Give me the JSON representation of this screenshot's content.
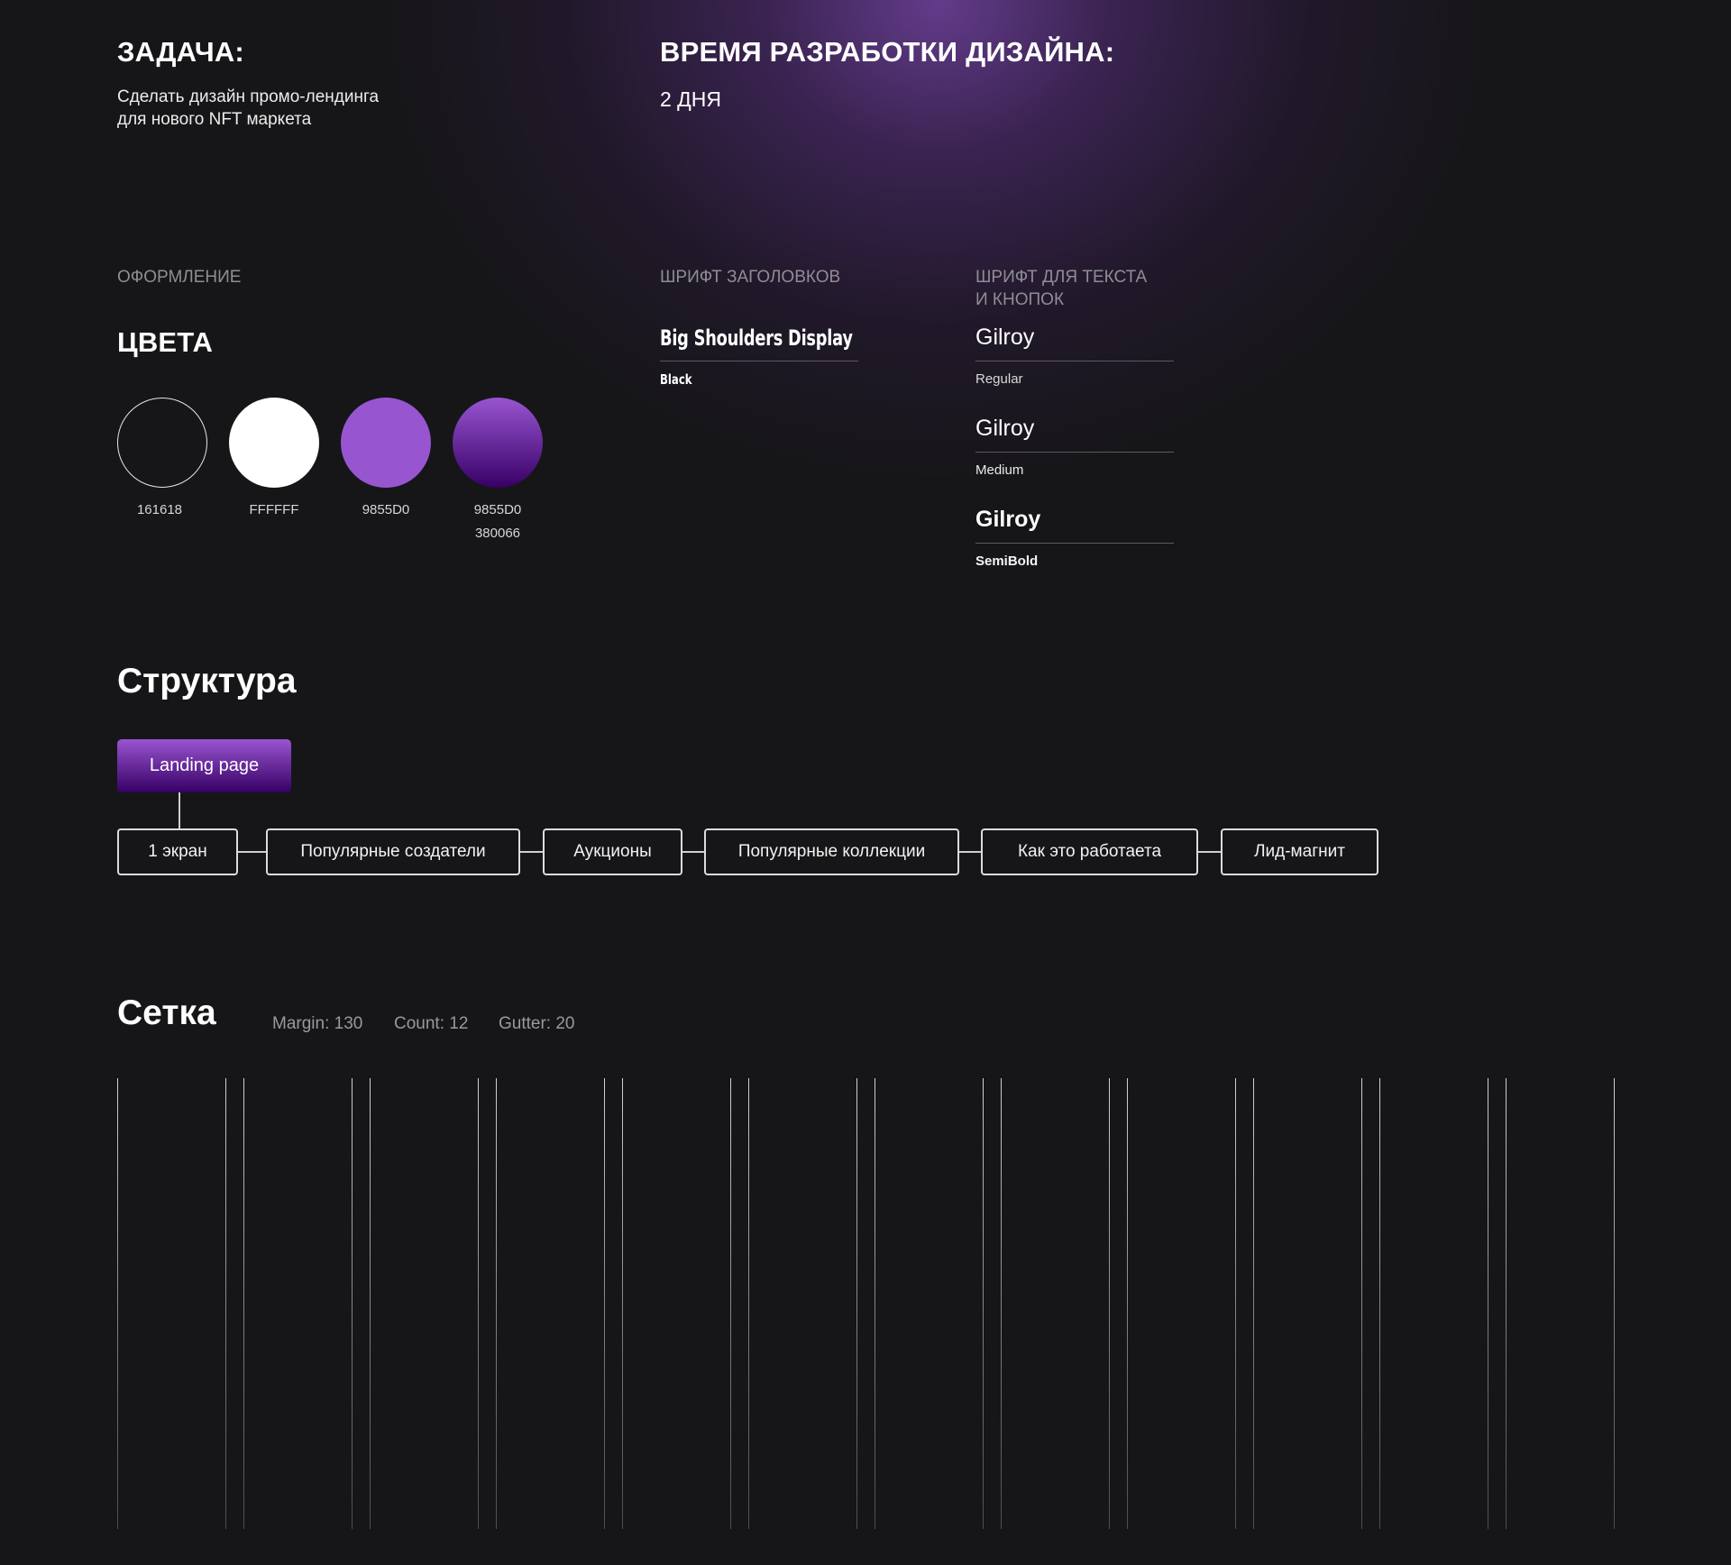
{
  "header": {
    "task_title": "ЗАДАЧА:",
    "task_text_line1": "Сделать дизайн промо-лендинга",
    "task_text_line2": "для нового NFT маркета",
    "time_title": "ВРЕМЯ РАЗРАБОТКИ ДИЗАЙНА:",
    "time_value": "2 ДНЯ"
  },
  "design": {
    "label": "ОФОРМЛЕНИЕ",
    "colors_title": "ЦВЕТА",
    "colors": [
      {
        "label": "161618",
        "hex": "#161618"
      },
      {
        "label": "FFFFFF",
        "hex": "#FFFFFF"
      },
      {
        "label": "9855D0",
        "hex": "#9855D0"
      },
      {
        "label": "9855D0",
        "label2": "380066",
        "hex": "#9855D0",
        "hex2": "#380066"
      }
    ]
  },
  "fonts": {
    "headings_label": "ШРИФТ ЗАГОЛОВКОВ",
    "headings_font": "Big Shoulders Display",
    "headings_style": "Black",
    "text_label_line1": "ШРИФТ ДЛЯ ТЕКСТА",
    "text_label_line2": "И КНОПОК",
    "text_fonts": [
      {
        "name": "Gilroy",
        "style": "Regular"
      },
      {
        "name": "Gilroy",
        "style": "Medium"
      },
      {
        "name": "Gilroy",
        "style": "SemiBold"
      }
    ]
  },
  "structure": {
    "title": "Структура",
    "root": "Landing page",
    "nodes": [
      "1 экран",
      "Популярные создатели",
      "Аукционы",
      "Популярные коллекции",
      "Как это работаета",
      "Лид-магнит"
    ]
  },
  "grid": {
    "title": "Сетка",
    "margin_text": "Margin: 130",
    "count_text": "Count: 12",
    "gutter_text": "Gutter: 20",
    "margin": 130,
    "count": 12,
    "gutter": 20
  }
}
